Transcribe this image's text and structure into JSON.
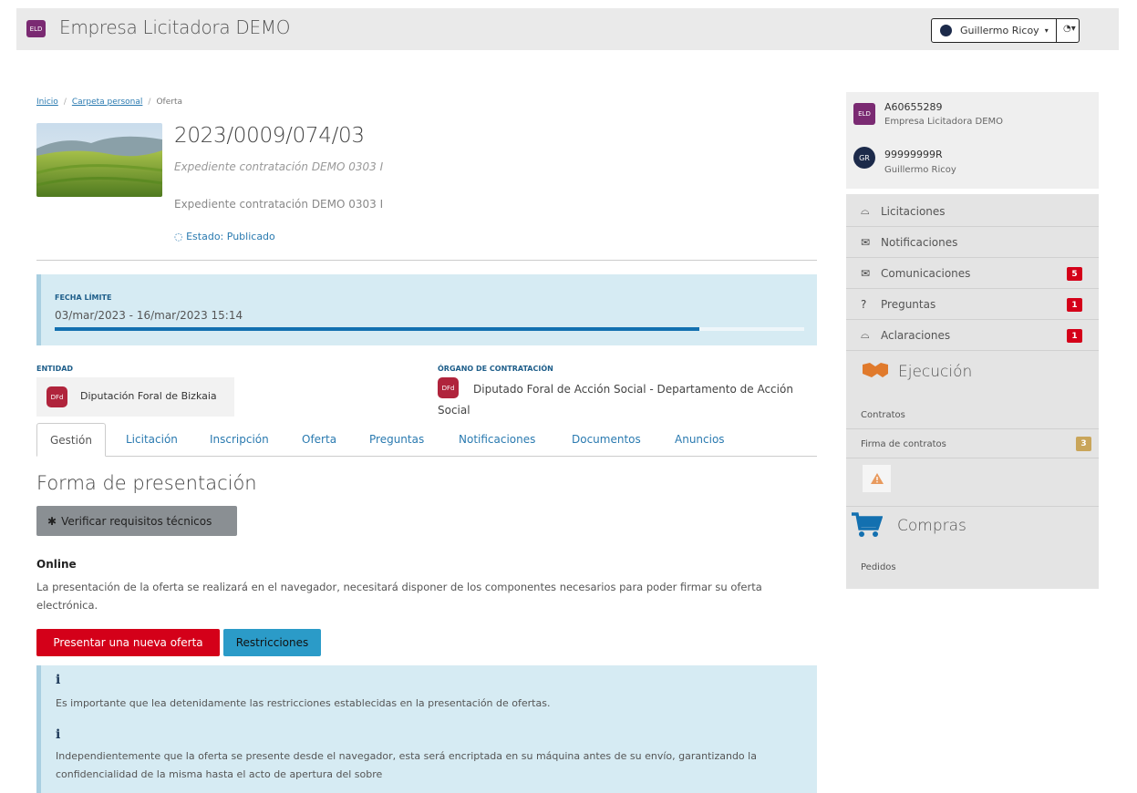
{
  "header": {
    "logo_text": "ELD",
    "title": "Empresa Licitadora DEMO",
    "user_name": "Guillermo Ricoy",
    "caret": "▾",
    "globe_menu": "◔▾"
  },
  "breadcrumb": {
    "items": [
      "Inicio",
      "Carpeta personal",
      "Oferta"
    ],
    "separator": "/"
  },
  "expediente": {
    "number": "2023/0009/074/03",
    "subtitle": "Expediente contratación DEMO 0303 I",
    "description": "Expediente contratación DEMO 0303 I",
    "estado_label": "Estado:",
    "estado_value": "Publicado"
  },
  "deadline": {
    "label": "FECHA LÍMITE",
    "dates": "03/mar/2023 - 16/mar/2023 15:14",
    "progress": 0.86
  },
  "entidad": {
    "label": "ENTIDAD",
    "icon_text": "DFd",
    "name": "Diputación Foral de Bizkaia"
  },
  "organo": {
    "label": "ÓRGANO DE CONTRATACIÓN",
    "icon_text": "DFd",
    "name": "Diputado Foral de Acción Social - Departamento de Acción Social"
  },
  "tabs": [
    "Gestión",
    "Licitación",
    "Inscripción",
    "Oferta",
    "Preguntas",
    "Notificaciones",
    "Documentos",
    "Anuncios"
  ],
  "main": {
    "section_title": "Forma de presentación",
    "verify_button": "Verificar requisitos técnicos",
    "online_title": "Online",
    "online_desc": "La presentación de la oferta se realizará en el navegador, necesitará disponer de los componentes necesarios para poder firmar su oferta electrónica.",
    "present_button": "Presentar una nueva oferta",
    "restrictions_button": "Restricciones",
    "info_symbol": "i",
    "info_1": "Es importante que lea detenidamente las restricciones establecidas en la presentación de ofertas.",
    "info_2": "Independientemente que la oferta se presente desde el navegador, esta será encriptada en su máquina antes de su envío, garantizando la confidencialidad de la misma hasta el acto de apertura del sobre"
  },
  "sidebar": {
    "company_badge": "ELD",
    "company_id": "A60655289",
    "company_name": "Empresa Licitadora DEMO",
    "user_badge": "GR",
    "user_id": "99999999R",
    "user_name": "Guillermo Ricoy",
    "menu": [
      {
        "label": "Licitaciones",
        "icon": "inbox-icon",
        "glyph": "⌓",
        "count": ""
      },
      {
        "label": "Notificaciones",
        "icon": "envelope-icon",
        "glyph": "✉",
        "count": ""
      },
      {
        "label": "Comunicaciones",
        "icon": "envelope-icon",
        "glyph": "✉",
        "count": "5"
      },
      {
        "label": "Preguntas",
        "icon": "question-icon",
        "glyph": "?",
        "count": "1"
      },
      {
        "label": "Aclaraciones",
        "icon": "inbox-icon",
        "glyph": "⌓",
        "count": "1"
      }
    ],
    "ejecucion_title": "Ejecución",
    "ejecucion_items": [
      {
        "label": "Contratos",
        "count": ""
      },
      {
        "label": "Firma de contratos",
        "count": "3"
      }
    ],
    "compras_title": "Compras",
    "compras_items": [
      "Pedidos"
    ]
  },
  "colors": {
    "brand_purple": "#7a2a72",
    "danger_red": "#d40019",
    "info_teal": "#2b9bc8",
    "progress_blue": "#1370b0",
    "info_bg": "#d6ebf3",
    "link_blue": "#2a7ab0"
  }
}
